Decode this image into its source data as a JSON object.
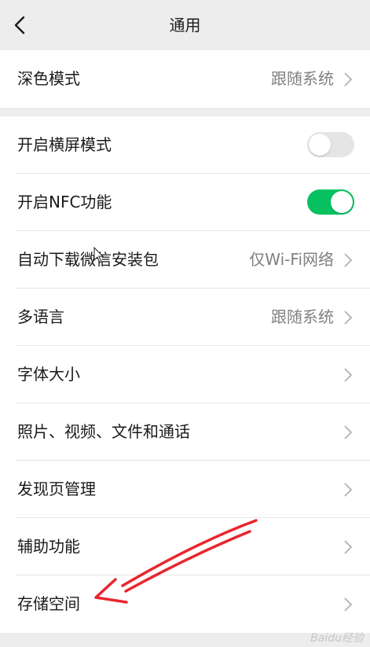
{
  "header": {
    "title": "通用"
  },
  "groups": [
    {
      "items": [
        {
          "label": "深色模式",
          "value": "跟随系统"
        }
      ]
    },
    {
      "items": [
        {
          "label": "开启横屏模式",
          "toggle": "off"
        },
        {
          "label": "开启NFC功能",
          "toggle": "on"
        },
        {
          "label": "自动下载微信安装包",
          "value": "仅Wi-Fi网络"
        },
        {
          "label": "多语言",
          "value": "跟随系统"
        },
        {
          "label": "字体大小"
        },
        {
          "label": "照片、视频、文件和通话"
        },
        {
          "label": "发现页管理"
        },
        {
          "label": "辅助功能"
        },
        {
          "label": "存储空间"
        }
      ]
    }
  ],
  "colors": {
    "toggle_on": "#07c160",
    "toggle_off": "#e5e5e5",
    "annotation_arrow": "#e8262e"
  },
  "icons": {
    "back": "chevron-left-icon",
    "row_arrow": "chevron-right-icon"
  },
  "watermark": "Baidu经验"
}
